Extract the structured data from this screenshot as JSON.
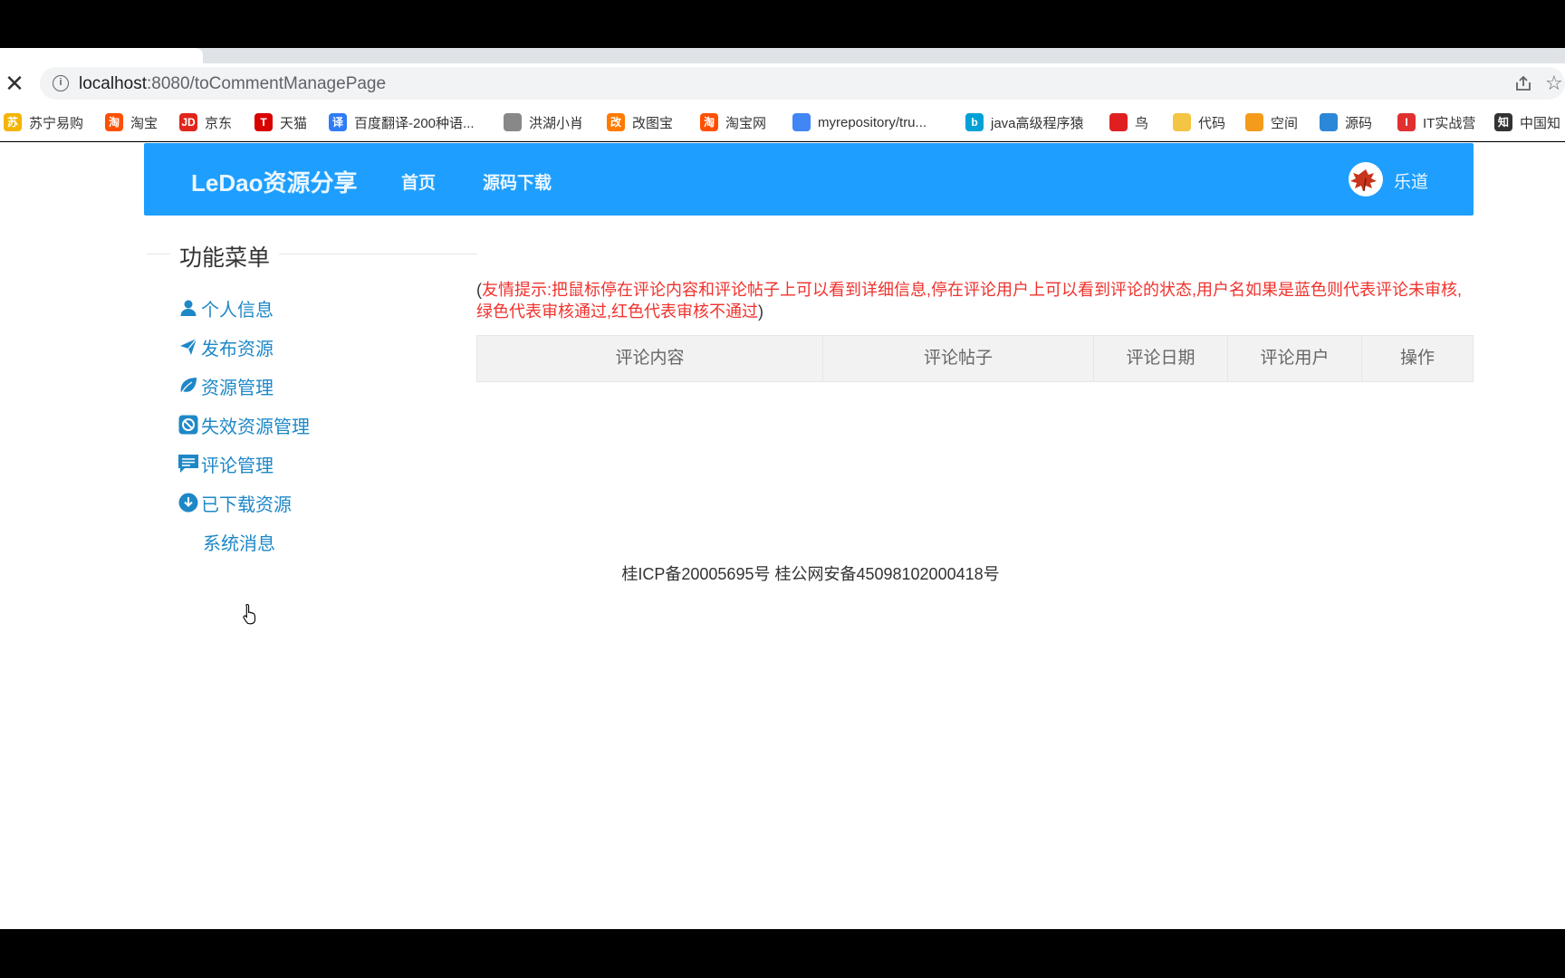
{
  "browser": {
    "url_host": "localhost",
    "url_path": ":8080/toCommentManagePage"
  },
  "bookmarks": [
    {
      "label": "苏宁易购",
      "icon": "suning-icon",
      "color": "#f5b400"
    },
    {
      "label": "淘宝",
      "icon": "taobao-icon",
      "color": "#ff5000"
    },
    {
      "label": "京东",
      "icon": "jd-icon",
      "color": "#e1251b"
    },
    {
      "label": "天猫",
      "icon": "tmall-icon",
      "color": "#d90000"
    },
    {
      "label": "百度翻译-200种语...",
      "icon": "baidu-translate-icon",
      "color": "#2f7cf6"
    },
    {
      "label": "洪湖小肖",
      "icon": "bird-icon",
      "color": "#888888"
    },
    {
      "label": "改图宝",
      "icon": "gaitubao-icon",
      "color": "#ff7a00"
    },
    {
      "label": "淘宝网",
      "icon": "taobao-net-icon",
      "color": "#ff5000"
    },
    {
      "label": "myrepository/tru...",
      "icon": "chrome-icon",
      "color": "#4285f4"
    },
    {
      "label": "java高级程序猿",
      "icon": "bilibili-icon",
      "color": "#00a1d6"
    },
    {
      "label": "鸟",
      "icon": "bird-red-icon",
      "color": "#e02020"
    },
    {
      "label": "代码",
      "icon": "code-icon",
      "color": "#f4c542"
    },
    {
      "label": "空间",
      "icon": "qzone-icon",
      "color": "#f59b1c"
    },
    {
      "label": "源码",
      "icon": "source-icon",
      "color": "#2b88d8"
    },
    {
      "label": "IT实战营",
      "icon": "it-icon",
      "color": "#e03030"
    },
    {
      "label": "中国知",
      "icon": "cnki-icon",
      "color": "#333333"
    }
  ],
  "header": {
    "logo": "LeDao资源分享",
    "nav": [
      "首页",
      "源码下载"
    ],
    "user_name": "乐道"
  },
  "menu": {
    "title": "功能菜单",
    "items": [
      {
        "label": "个人信息",
        "icon": "user-icon"
      },
      {
        "label": "发布资源",
        "icon": "paper-plane-icon"
      },
      {
        "label": "资源管理",
        "icon": "leaf-icon"
      },
      {
        "label": "失效资源管理",
        "icon": "ban-icon"
      },
      {
        "label": "评论管理",
        "icon": "comment-icon"
      },
      {
        "label": "已下载资源",
        "icon": "download-icon"
      },
      {
        "label": "系统消息",
        "icon": ""
      }
    ]
  },
  "tip": {
    "open": "(",
    "text": "友情提示:把鼠标停在评论内容和评论帖子上可以看到详细信息,停在评论用户上可以看到评论的状态,用户名如果是蓝色则代表评论未审核,绿色代表审核通过,红色代表审核不通过",
    "close": ")"
  },
  "table": {
    "columns": [
      "评论内容",
      "评论帖子",
      "评论日期",
      "评论用户",
      "操作"
    ]
  },
  "footer": {
    "text": "桂ICP备20005695号 桂公网安备45098102000418号"
  },
  "colors": {
    "header_bg": "#1e9fff",
    "menu_link": "#1e88c7",
    "tip_text": "#f0322d"
  }
}
